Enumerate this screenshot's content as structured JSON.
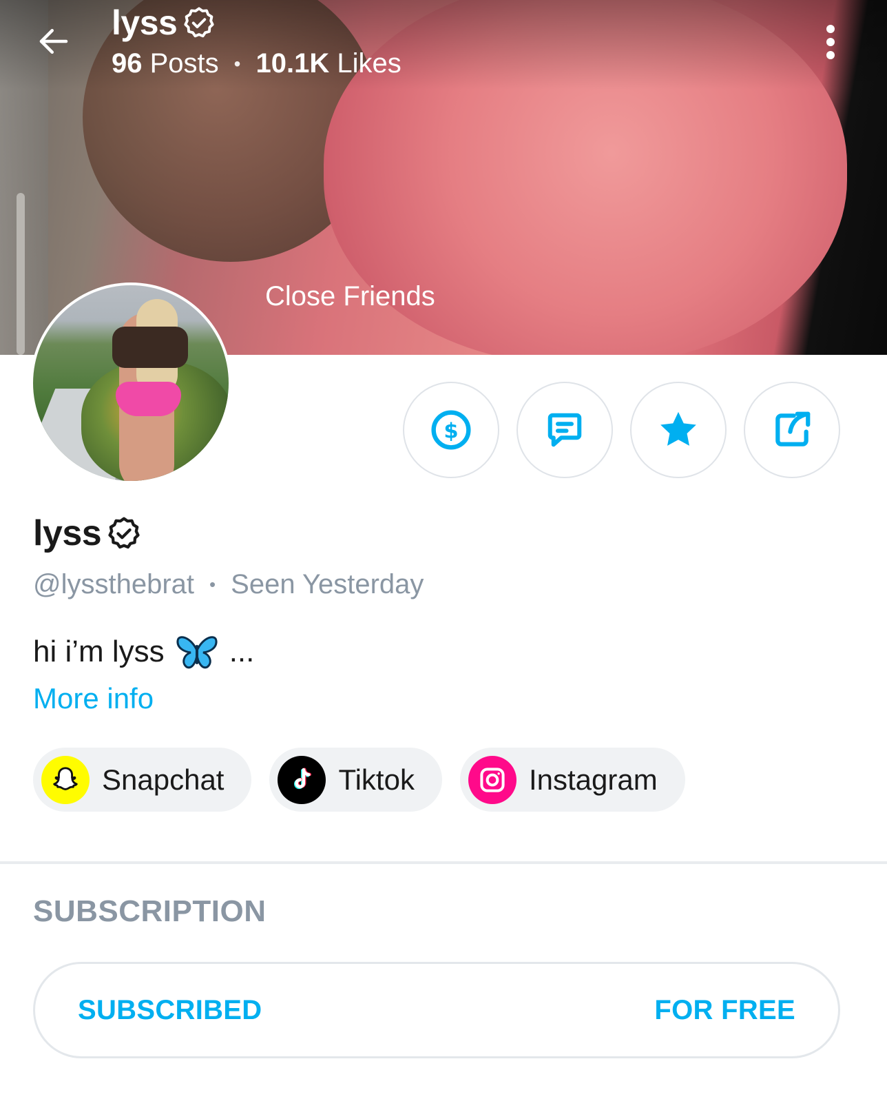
{
  "header": {
    "name": "lyss",
    "posts_count": "96",
    "posts_label": "Posts",
    "likes_count": "10.1K",
    "likes_label": "Likes",
    "separator": "•"
  },
  "cover": {
    "label": "Close Friends"
  },
  "profile": {
    "name": "lyss",
    "handle": "@lyssthebrat",
    "separator": "•",
    "last_seen": "Seen Yesterday",
    "bio": "hi i’m lyss",
    "bio_more": "...",
    "more_info": "More info"
  },
  "socials": [
    {
      "label": "Snapchat",
      "icon": "snapchat-icon",
      "color": "#fffc00"
    },
    {
      "label": "Tiktok",
      "icon": "tiktok-icon",
      "color": "#000000"
    },
    {
      "label": "Instagram",
      "icon": "instagram-icon",
      "color": "#ff0a8a"
    }
  ],
  "subscription": {
    "heading": "SUBSCRIPTION",
    "status": "SUBSCRIBED",
    "price": "FOR FREE"
  },
  "colors": {
    "accent": "#00aff0",
    "muted_text": "#8a96a3"
  }
}
